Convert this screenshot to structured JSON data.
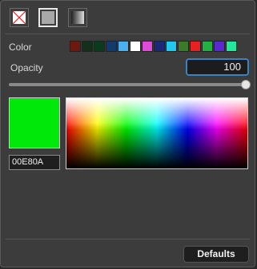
{
  "fill_types": [
    {
      "name": "none-fill-icon",
      "selected": false
    },
    {
      "name": "solid-fill-icon",
      "selected": true
    },
    {
      "name": "gradient-fill-icon",
      "selected": false
    }
  ],
  "color": {
    "label": "Color",
    "swatches": [
      "#6b1a10",
      "#14301a",
      "#0c3a1c",
      "#123a6a",
      "#4ab0f0",
      "#ffffff",
      "#e04ad8",
      "#1a2a78",
      "#22c8f0",
      "#3a7a28",
      "#e82020",
      "#22b040",
      "#5a2ad0",
      "#22e8a0"
    ]
  },
  "opacity": {
    "label": "Opacity",
    "value": "100",
    "fraction": 1.0
  },
  "current_color": {
    "hex": "00E80A",
    "swatch": "#00e80a"
  },
  "footer": {
    "defaults_label": "Defaults"
  }
}
